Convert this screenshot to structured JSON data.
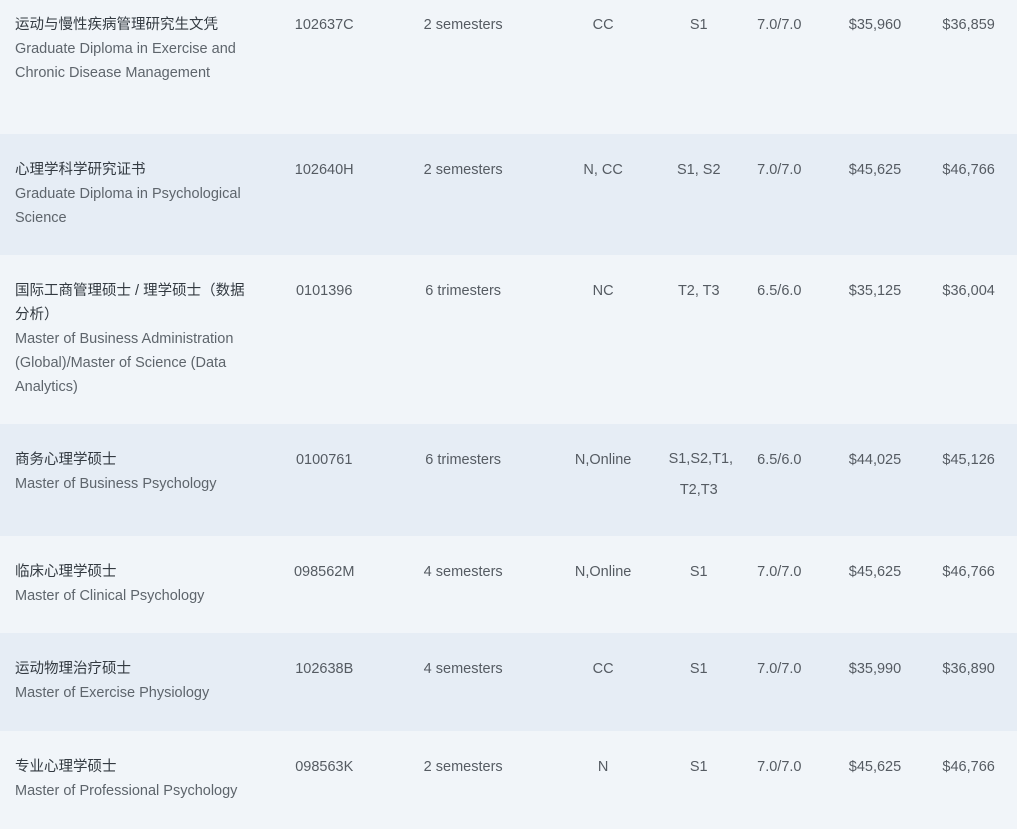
{
  "rows": [
    {
      "zh": "运动与慢性疾病管理研究生文凭",
      "en": "Graduate Diploma in Exercise and Chronic Disease Management",
      "code": "102637C",
      "duration": "2 semesters",
      "location": "CC",
      "intake": "S1",
      "ielts": "7.0/7.0",
      "fee1": "$35,960",
      "fee2": "$36,859"
    },
    {
      "zh": "心理学科学研究证书",
      "en": "Graduate Diploma in Psychological Science",
      "code": "102640H",
      "duration": "2 semesters",
      "location": "N, CC",
      "intake": "S1, S2",
      "ielts": "7.0/7.0",
      "fee1": "$45,625",
      "fee2": "$46,766"
    },
    {
      "zh": "国际工商管理硕士 / 理学硕士（数据分析）",
      "en": "Master of Business Administration (Global)/Master of Science (Data Analytics)",
      "code": "0101396",
      "duration": "6 trimesters",
      "location": "NC",
      "intake": "T2, T3",
      "ielts": "6.5/6.0",
      "fee1": "$35,125",
      "fee2": "$36,004"
    },
    {
      "zh": "商务心理学硕士",
      "en": "Master of Business Psychology",
      "code": "0100761",
      "duration": "6 trimesters",
      "location": "N,Online",
      "intake": "S1,S2,T1, T2,T3",
      "ielts": "6.5/6.0",
      "fee1": "$44,025",
      "fee2": "$45,126"
    },
    {
      "zh": "临床心理学硕士",
      "en": "Master of Clinical Psychology",
      "code": "098562M",
      "duration": "4 semesters",
      "location": "N,Online",
      "intake": "S1",
      "ielts": "7.0/7.0",
      "fee1": "$45,625",
      "fee2": "$46,766"
    },
    {
      "zh": "运动物理治疗硕士",
      "en": "Master of Exercise Physiology",
      "code": "102638B",
      "duration": "4 semesters",
      "location": "CC",
      "intake": "S1",
      "ielts": "7.0/7.0",
      "fee1": "$35,990",
      "fee2": "$36,890"
    },
    {
      "zh": "专业心理学硕士",
      "en": "Master of Professional Psychology",
      "code": "098563K",
      "duration": "2 semesters",
      "location": "N",
      "intake": "S1",
      "ielts": "7.0/7.0",
      "fee1": "$45,625",
      "fee2": "$46,766"
    }
  ]
}
